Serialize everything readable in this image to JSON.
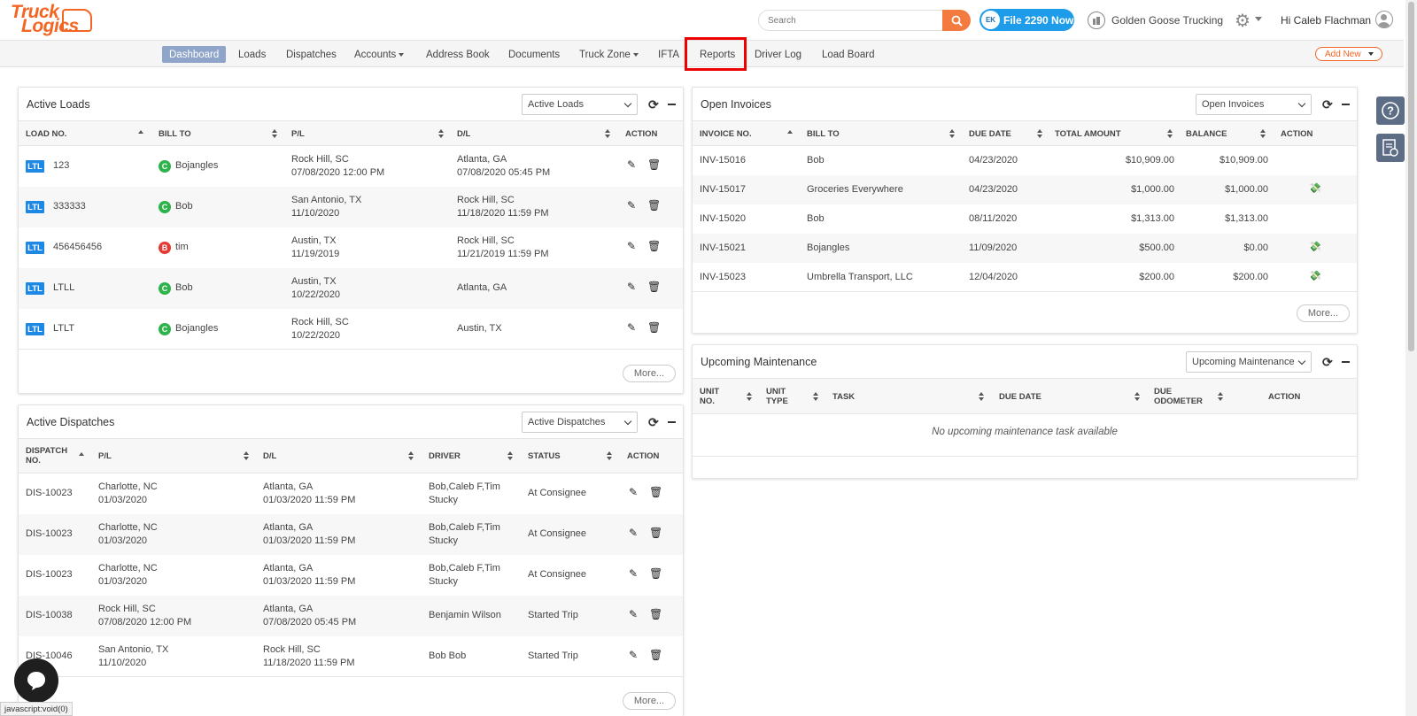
{
  "brand": {
    "line1": "Truck",
    "line2": "Logics",
    "accent": "#f26522"
  },
  "header": {
    "search_placeholder": "Search",
    "file2290_badge": "EK",
    "file2290_label": "File 2290 Now",
    "company": "Golden Goose Trucking",
    "greeting": "Hi Caleb Flachman"
  },
  "nav": {
    "items": [
      "Dashboard",
      "Loads",
      "Dispatches",
      "Accounts",
      "Address Book",
      "Documents",
      "Truck Zone",
      "IFTA",
      "Reports",
      "Driver Log",
      "Load Board"
    ],
    "active": "Dashboard",
    "highlighted": "Reports",
    "add_new": "Add New"
  },
  "active_loads": {
    "title": "Active Loads",
    "select": "Active Loads",
    "columns": [
      "LOAD NO.",
      "BILL TO",
      "P/L",
      "D/L",
      "ACTION"
    ],
    "rows": [
      {
        "tag": "LTL",
        "load_no": "123",
        "badge": "C",
        "bill_to": "Bojangles",
        "pl1": "Rock Hill, SC",
        "pl2": "07/08/2020 12:00 PM",
        "dl1": "Atlanta, GA",
        "dl2": "07/08/2020 05:45 PM"
      },
      {
        "tag": "LTL",
        "load_no": "333333",
        "badge": "C",
        "bill_to": "Bob",
        "pl1": "San Antonio, TX",
        "pl2": "11/10/2020",
        "dl1": "Rock Hill, SC",
        "dl2": "11/18/2020 11:59 PM"
      },
      {
        "tag": "LTL",
        "load_no": "456456456",
        "badge": "B",
        "bill_to": "tim",
        "pl1": "Austin, TX",
        "pl2": "11/19/2019",
        "dl1": "Rock Hill, SC",
        "dl2": "11/21/2019 11:59 PM"
      },
      {
        "tag": "LTL",
        "load_no": "LTLL",
        "badge": "C",
        "bill_to": "Bob",
        "pl1": "Austin, TX",
        "pl2": "10/22/2020",
        "dl1": "Atlanta, GA",
        "dl2": ""
      },
      {
        "tag": "LTL",
        "load_no": "LTLT",
        "badge": "C",
        "bill_to": "Bojangles",
        "pl1": "Rock Hill, SC",
        "pl2": "10/22/2020",
        "dl1": "Austin, TX",
        "dl2": ""
      }
    ],
    "more": "More..."
  },
  "active_dispatches": {
    "title": "Active Dispatches",
    "select": "Active Dispatches",
    "columns": [
      "DISPATCH",
      "NO.",
      "P/L",
      "D/L",
      "DRIVER",
      "STATUS",
      "ACTION"
    ],
    "rows": [
      {
        "no": "DIS-10023",
        "pl1": "Charlotte, NC",
        "pl2": "01/03/2020",
        "dl1": "Atlanta, GA",
        "dl2": "01/03/2020 11:59 PM",
        "driver1": "Bob,Caleb F,Tim",
        "driver2": "Stucky",
        "status": "At Consignee"
      },
      {
        "no": "DIS-10023",
        "pl1": "Charlotte, NC",
        "pl2": "01/03/2020",
        "dl1": "Atlanta, GA",
        "dl2": "01/03/2020 11:59 PM",
        "driver1": "Bob,Caleb F,Tim",
        "driver2": "Stucky",
        "status": "At Consignee"
      },
      {
        "no": "DIS-10023",
        "pl1": "Charlotte, NC",
        "pl2": "01/03/2020",
        "dl1": "Atlanta, GA",
        "dl2": "01/03/2020 11:59 PM",
        "driver1": "Bob,Caleb F,Tim",
        "driver2": "Stucky",
        "status": "At Consignee"
      },
      {
        "no": "DIS-10038",
        "pl1": "Rock Hill, SC",
        "pl2": "07/08/2020 12:00 PM",
        "dl1": "Atlanta, GA",
        "dl2": "07/08/2020 05:45 PM",
        "driver1": "Benjamin Wilson",
        "driver2": "",
        "status": "Started Trip"
      },
      {
        "no": "DIS-10046",
        "pl1": "San Antonio, TX",
        "pl2": "11/10/2020",
        "dl1": "Rock Hill, SC",
        "dl2": "11/18/2020 11:59 PM",
        "driver1": "Bob Bob",
        "driver2": "",
        "status": "Started Trip"
      }
    ],
    "more": "More..."
  },
  "open_invoices": {
    "title": "Open Invoices",
    "select": "Open Invoices",
    "columns": [
      "INVOICE NO.",
      "BILL TO",
      "DUE DATE",
      "TOTAL AMOUNT",
      "BALANCE",
      "ACTION"
    ],
    "rows": [
      {
        "invoice": "INV-15016",
        "bill_to": "Bob",
        "due": "04/23/2020",
        "total": "$10,909.00",
        "balance": "$10,909.00",
        "action": ""
      },
      {
        "invoice": "INV-15017",
        "bill_to": "Groceries Everywhere",
        "due": "04/23/2020",
        "total": "$1,000.00",
        "balance": "$1,000.00",
        "action": "receive"
      },
      {
        "invoice": "INV-15020",
        "bill_to": "Bob",
        "due": "08/11/2020",
        "total": "$1,313.00",
        "balance": "$1,313.00",
        "action": ""
      },
      {
        "invoice": "INV-15021",
        "bill_to": "Bojangles",
        "due": "11/09/2020",
        "total": "$500.00",
        "balance": "$0.00",
        "action": "receive"
      },
      {
        "invoice": "INV-15023",
        "bill_to": "Umbrella Transport, LLC",
        "due": "12/04/2020",
        "total": "$200.00",
        "balance": "$200.00",
        "action": "receive"
      }
    ],
    "more": "More..."
  },
  "maintenance": {
    "title": "Upcoming Maintenance",
    "select": "Upcoming Maintenance",
    "columns": [
      "UNIT",
      "NO.",
      "UNIT",
      "TYPE",
      "TASK",
      "DUE DATE",
      "DUE",
      "ODOMETER",
      "ACTION"
    ],
    "empty": "No upcoming maintenance task available"
  },
  "status_bar": "javascript:void(0)",
  "icons": [
    "search-icon",
    "gear-icon",
    "user-icon",
    "refresh-icon",
    "edit-icon",
    "trash-icon",
    "receive-payment-icon",
    "help-icon",
    "report-icon",
    "chat-icon"
  ]
}
